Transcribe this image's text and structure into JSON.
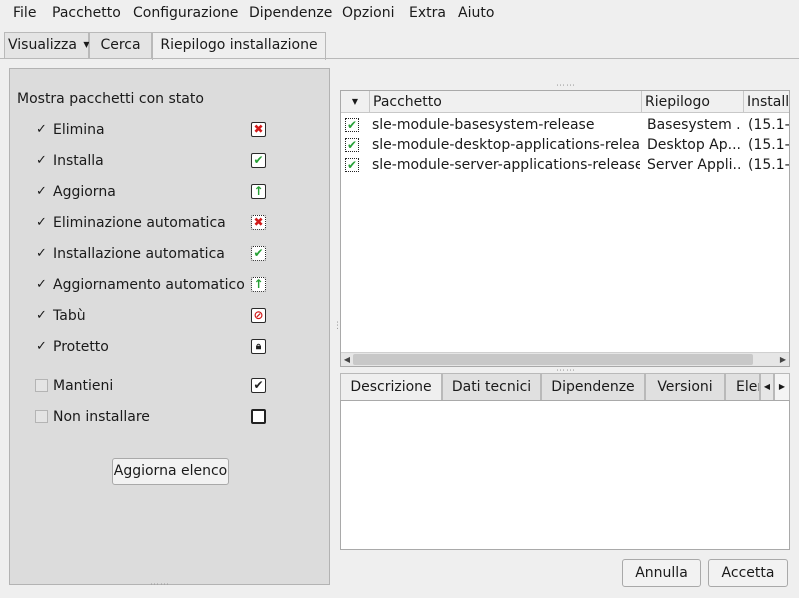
{
  "menubar": {
    "items": [
      {
        "label": "File"
      },
      {
        "label": "Pacchetto"
      },
      {
        "label": "Configurazione"
      },
      {
        "label": "Dipendenze"
      },
      {
        "label": "Opzioni"
      },
      {
        "label": "Extra"
      },
      {
        "label": "Aiuto"
      }
    ]
  },
  "tabs": {
    "view_label": "Visualizza",
    "search_label": "Cerca",
    "summary_label": "Riepilogo installazione"
  },
  "left_panel": {
    "title": "Mostra pacchetti con stato",
    "statuses": [
      {
        "label": "Elimina",
        "checked": true,
        "icon": "delete-icon"
      },
      {
        "label": "Installa",
        "checked": true,
        "icon": "install-icon"
      },
      {
        "label": "Aggiorna",
        "checked": true,
        "icon": "update-icon"
      },
      {
        "label": "Eliminazione automatica",
        "checked": true,
        "icon": "auto-delete-icon"
      },
      {
        "label": "Installazione automatica",
        "checked": true,
        "icon": "auto-install-icon"
      },
      {
        "label": "Aggiornamento automatico",
        "checked": true,
        "icon": "auto-update-icon"
      },
      {
        "label": "Tabù",
        "checked": true,
        "icon": "taboo-icon"
      },
      {
        "label": "Protetto",
        "checked": true,
        "icon": "lock-icon"
      },
      {
        "label": "Mantieni",
        "checked": false,
        "icon": "keep-icon"
      },
      {
        "label": "Non installare",
        "checked": false,
        "icon": "no-install-icon"
      }
    ],
    "refresh_label": "Aggiorna elenco"
  },
  "packages": {
    "columns": [
      "Pacchetto",
      "Riepilogo",
      "Installa"
    ],
    "rows": [
      {
        "name": "sle-module-basesystem-release",
        "summary": "Basesystem ...",
        "version": "(15.1-"
      },
      {
        "name": "sle-module-desktop-applications-release",
        "summary": "Desktop Ap...",
        "version": "(15.1-"
      },
      {
        "name": "sle-module-server-applications-release",
        "summary": "Server Appli...",
        "version": "(15.1-"
      }
    ]
  },
  "details": {
    "tabs": [
      {
        "label": "Descrizione"
      },
      {
        "label": "Dati tecnici"
      },
      {
        "label": "Dipendenze"
      },
      {
        "label": "Versioni"
      },
      {
        "label": "Elen"
      }
    ]
  },
  "buttons": {
    "cancel_label": "Annulla",
    "accept_label": "Accetta"
  },
  "colors": {
    "delete": "#d11a1a",
    "ok": "#27a036"
  }
}
